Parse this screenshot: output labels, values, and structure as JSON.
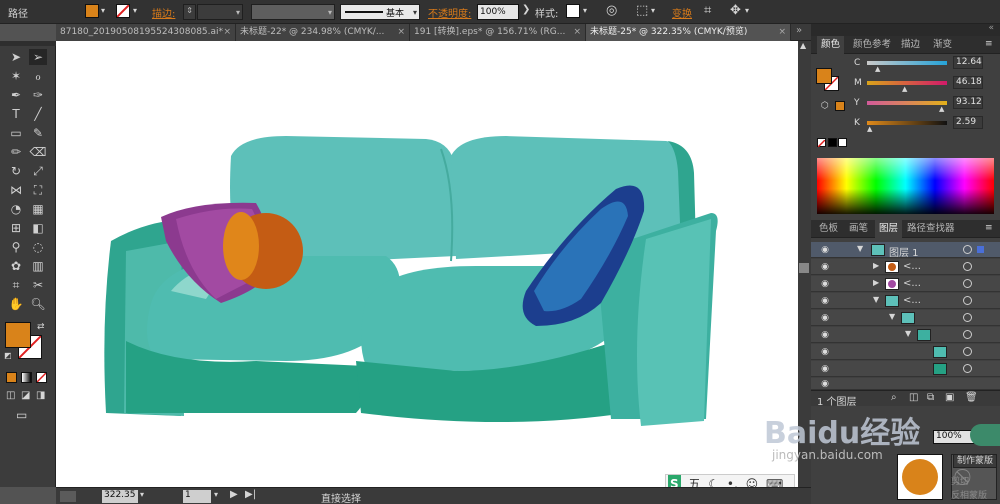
{
  "control_bar": {
    "path_label": "路径",
    "stroke_label": "描边:",
    "brush_label": "基本",
    "opacity_label": "不透明度:",
    "opacity_value": "100%",
    "style_label": "样式:",
    "transform_label": "变换"
  },
  "tabs": [
    {
      "label": "87180_20190508195524308085.ai*"
    },
    {
      "label": "未标题-22* @ 234.98% (CMYK/..."
    },
    {
      "label": "191 [转换].eps* @ 156.71% (RG..."
    },
    {
      "label": "未标题-25* @ 322.35% (CMYK/预览)"
    }
  ],
  "color_panel": {
    "tabs": [
      "颜色",
      "颜色参考",
      "描边",
      "渐变"
    ],
    "sliders": [
      {
        "label": "C",
        "value": "12.64"
      },
      {
        "label": "M",
        "value": "46.18"
      },
      {
        "label": "Y",
        "value": "93.12"
      },
      {
        "label": "K",
        "value": "2.59"
      }
    ],
    "fill_color": "#d9831a"
  },
  "layers_panel": {
    "tabs": [
      "色板",
      "画笔",
      "图层",
      "路径查找器"
    ],
    "top_layer": "图层 1",
    "sublayers": [
      "<...",
      "<...",
      "<..."
    ],
    "footer": "1 个图层"
  },
  "transparency": {
    "value": "100%",
    "make_mask": "制作蒙版",
    "clip": "剪切",
    "invert_mask": "反相蒙版"
  },
  "status": {
    "zoom": "322.35",
    "page": "1",
    "tool": "直接选择"
  },
  "ime": {
    "label": "五"
  },
  "watermark": {
    "text": "Baidu经验",
    "url": "jingyan.baidu.com"
  }
}
